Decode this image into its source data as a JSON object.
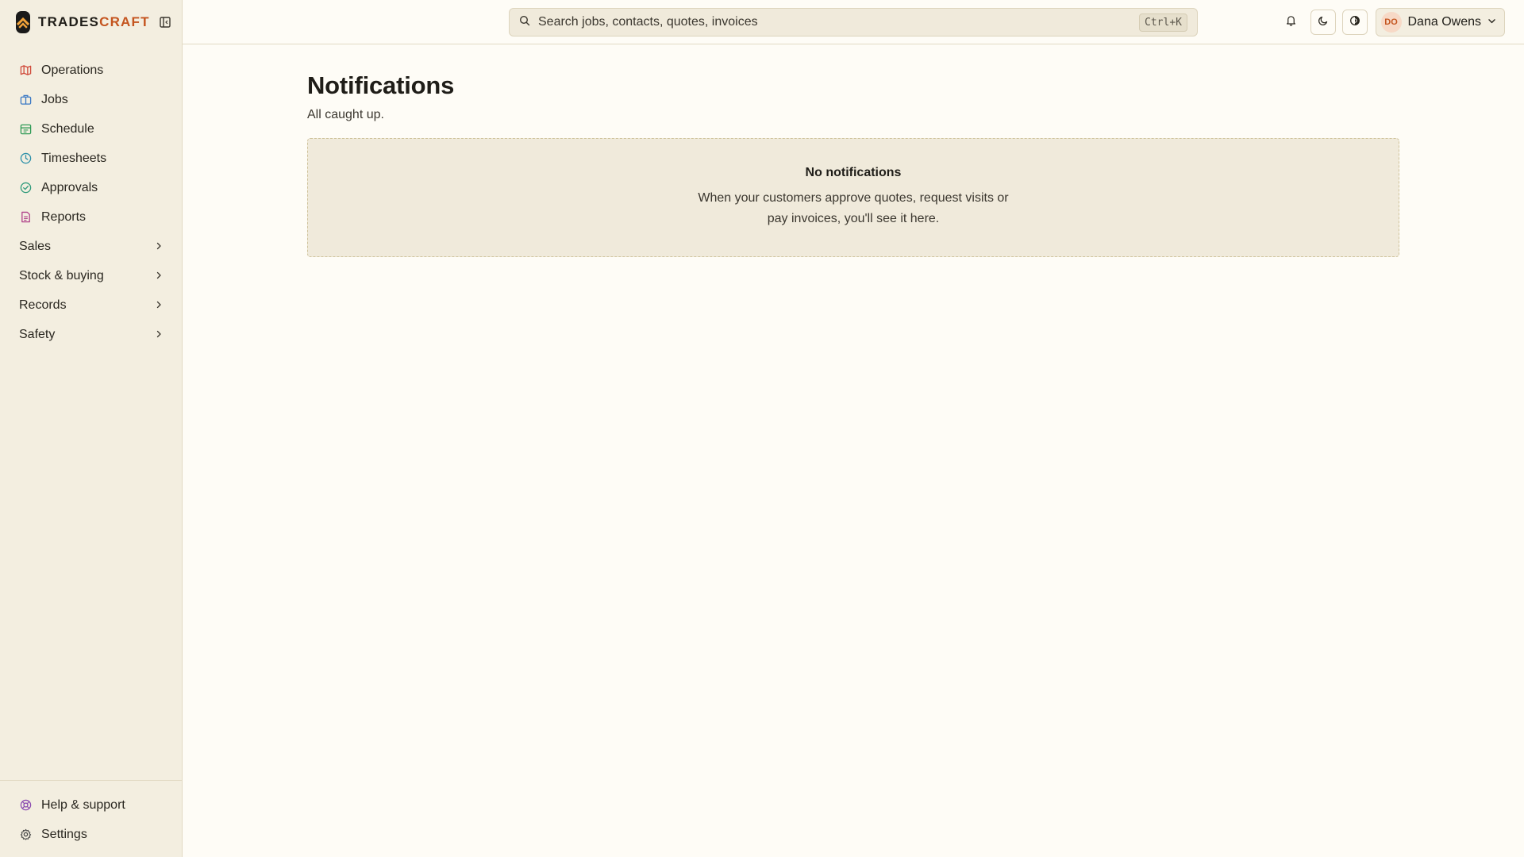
{
  "brand": {
    "name_main": "TRADES",
    "name_accent": "CRAFT"
  },
  "sidebar": {
    "items": [
      {
        "label": "Operations",
        "icon": "map-icon",
        "color": "#d04a3a"
      },
      {
        "label": "Jobs",
        "icon": "briefcase-icon",
        "color": "#3a78c4"
      },
      {
        "label": "Schedule",
        "icon": "calendar-icon",
        "color": "#2e9a55"
      },
      {
        "label": "Timesheets",
        "icon": "clock-icon",
        "color": "#2a8fa8"
      },
      {
        "label": "Approvals",
        "icon": "check-circle-icon",
        "color": "#2e9a7a"
      },
      {
        "label": "Reports",
        "icon": "report-icon",
        "color": "#b0428a"
      }
    ],
    "groups": [
      {
        "label": "Sales"
      },
      {
        "label": "Stock & buying"
      },
      {
        "label": "Records"
      },
      {
        "label": "Safety"
      }
    ],
    "bottom": [
      {
        "label": "Help & support",
        "icon": "lifebuoy-icon",
        "color": "#8a4ab0"
      },
      {
        "label": "Settings",
        "icon": "gear-icon",
        "color": "#4a4a4a"
      }
    ]
  },
  "search": {
    "placeholder": "Search jobs, contacts, quotes, invoices",
    "shortcut": "Ctrl+K"
  },
  "user": {
    "initials": "DO",
    "name": "Dana Owens"
  },
  "page": {
    "title": "Notifications",
    "subtitle": "All caught up.",
    "empty_title": "No notifications",
    "empty_text": "When your customers approve quotes, request visits or pay invoices, you'll see it here."
  }
}
